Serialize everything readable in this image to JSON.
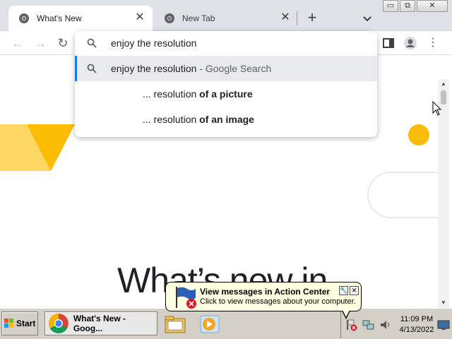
{
  "browser": {
    "tabs": [
      {
        "label": "What's New",
        "active": true,
        "icon": "chrome-icon"
      },
      {
        "label": "New Tab",
        "active": false,
        "icon": "chrome-icon"
      }
    ],
    "new_tab_symbol": "+",
    "close_symbol": "✕",
    "window_controls": {
      "minimize": "▭",
      "maximize": "⧉",
      "close": "✕"
    }
  },
  "toolbar": {
    "back_symbol": "←",
    "forward_symbol": "→",
    "reload_symbol": "↻",
    "menu_symbol": "⋮"
  },
  "omnibox": {
    "input_value": "enjoy the resolution",
    "suggestions": [
      {
        "main": "enjoy the resolution",
        "suffix": " - Google Search",
        "type": "search"
      },
      {
        "prefix": "... resolution ",
        "bold": "of a picture",
        "type": "completion"
      },
      {
        "prefix": "... resolution ",
        "bold": "of an image",
        "type": "completion"
      }
    ]
  },
  "page": {
    "headline": "What’s new in",
    "accent_colors": {
      "yellow": "#fbbc04",
      "light_yellow": "#fdd663"
    }
  },
  "taskbar": {
    "start_label": "Start",
    "task_button_label": "What's New - Goog...",
    "clock_time": "11:09 PM",
    "clock_date": "4/13/2022"
  },
  "balloon": {
    "title": "View messages in Action Center",
    "text": "Click to view messages about your computer.",
    "close_symbol": "✕",
    "options_symbol": "🔧"
  }
}
